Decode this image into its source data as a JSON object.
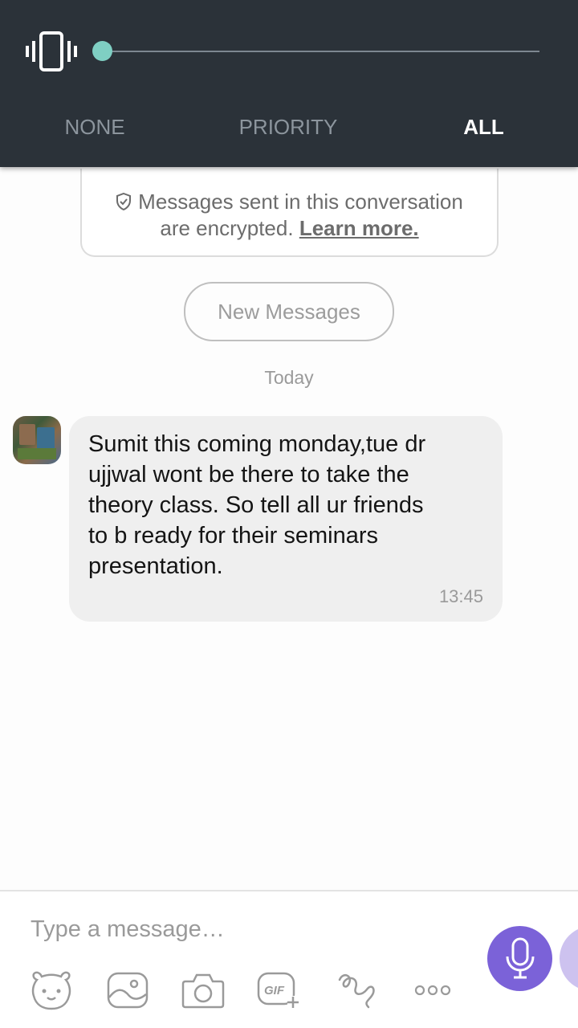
{
  "volume_panel": {
    "level": 0,
    "modes": [
      "NONE",
      "PRIORITY",
      "ALL"
    ],
    "selected_mode": "ALL",
    "colors": {
      "background": "#2b3239",
      "accent": "#7fcfc3",
      "inactive_text": "#8c959d",
      "active_text": "#ffffff"
    }
  },
  "encryption": {
    "line1": "Messages sent in this conversation",
    "line2": "are encrypted.",
    "link": "Learn more."
  },
  "new_messages_label": "New Messages",
  "date_separator": "Today",
  "message": {
    "lines": [
      "Sumit this coming monday,tue dr",
      "ujjwal wont be there to take the",
      "theory class. So tell all ur friends",
      "to b ready for their seminars",
      "presentation."
    ],
    "time": "13:45"
  },
  "composer": {
    "placeholder": "Type a message…",
    "tools": [
      "sticker-icon",
      "gallery-icon",
      "camera-icon",
      "gif-icon",
      "doodle-icon",
      "more-icon"
    ],
    "send_button_icon": "microphone-icon",
    "colors": {
      "mic_button": "#7b62d8"
    }
  }
}
